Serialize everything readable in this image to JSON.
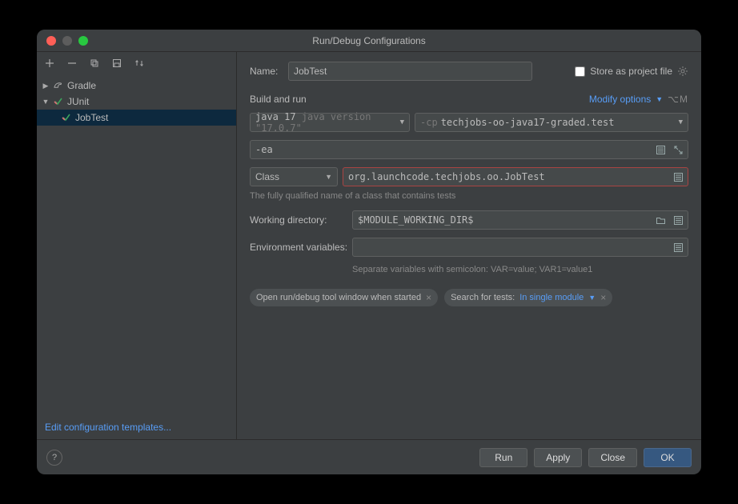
{
  "window": {
    "title": "Run/Debug Configurations"
  },
  "tree": {
    "gradle": "Gradle",
    "junit": "JUnit",
    "jobtest": "JobTest"
  },
  "sidebar": {
    "edit_templates": "Edit configuration templates..."
  },
  "form": {
    "name_label": "Name:",
    "name_value": "JobTest",
    "store_label": "Store as project file",
    "section": "Build and run",
    "modify": "Modify options",
    "shortcut": "⌥M",
    "jdk_prefix": "java 17",
    "jdk_version": "java version \"17.0.7\"",
    "cp_prefix": "-cp",
    "cp_value": "techjobs-oo-java17-graded.test",
    "vm": "-ea",
    "class_sel": "Class",
    "class_value": "org.launchcode.techjobs.oo.JobTest",
    "class_hint": "The fully qualified name of a class that contains tests",
    "wd_label": "Working directory:",
    "wd_value": "$MODULE_WORKING_DIR$",
    "env_label": "Environment variables:",
    "env_value": "",
    "env_hint": "Separate variables with semicolon: VAR=value; VAR1=value1",
    "tag1": "Open run/debug tool window when started",
    "tag2_pre": "Search for tests:",
    "tag2_link": "In single module"
  },
  "footer": {
    "run": "Run",
    "apply": "Apply",
    "close": "Close",
    "ok": "OK"
  }
}
